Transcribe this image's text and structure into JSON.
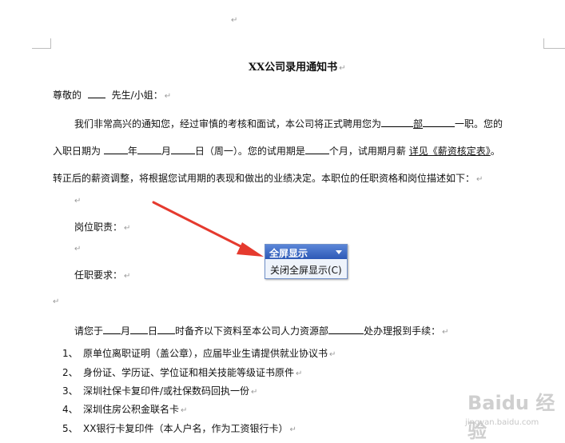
{
  "document": {
    "title": "XX公司录用通知书",
    "greeting": {
      "prefix": "尊敬的",
      "suffix": "先生/小姐："
    },
    "paragraph1": {
      "line1_a": "我们非常高兴的通知您，经过审慎的考核和面试，本公司将正式聘用您为",
      "line1_dept": "部",
      "line1_b": "一职。您的",
      "line2_a": "入职日期为",
      "line2_year": "年",
      "line2_month": "月",
      "line2_day": "日（周一）。您的试用期是",
      "line2_b": "个月，试用期月薪",
      "line2_link": "详见《薪资核定表》",
      "line2_end": "。",
      "line3": "转正后的薪资调整，将根据您试用期的表现和做出的业绩决定。本职位的任职资格和岗位描述如下："
    },
    "duties_label": "岗位职责：",
    "requirements_label": "任职要求：",
    "report_line": {
      "a": "请您于",
      "month": "月",
      "day": "日",
      "b": "时备齐以下资料至本公司人力资源部",
      "c": "处办理报到手续："
    },
    "materials": [
      {
        "num": "1、",
        "text": "原单位离职证明（盖公章），应届毕业生请提供就业协议书"
      },
      {
        "num": "2、",
        "text": "身份证、学历证、学位证和相关技能等级证书原件"
      },
      {
        "num": "3、",
        "text": "深圳社保卡复印件/或社保数码回执一份"
      },
      {
        "num": "4、",
        "text": "深圳住房公积金联名卡"
      },
      {
        "num": "5、",
        "text": "XX银行卡复印件（本人户名，作为工资银行卡）"
      }
    ],
    "paragraph_mark": "↵"
  },
  "fullscreen_toolbar": {
    "title": "全屏显示",
    "close_label": "关闭全屏显示(C)"
  },
  "watermark": {
    "brand": "Baidu 经验",
    "url": "jingyan.baidu.com"
  },
  "colors": {
    "arrow": "#e53a2e",
    "toolbar_title": "#2d59b6",
    "paragraph_mark": "#999999"
  }
}
